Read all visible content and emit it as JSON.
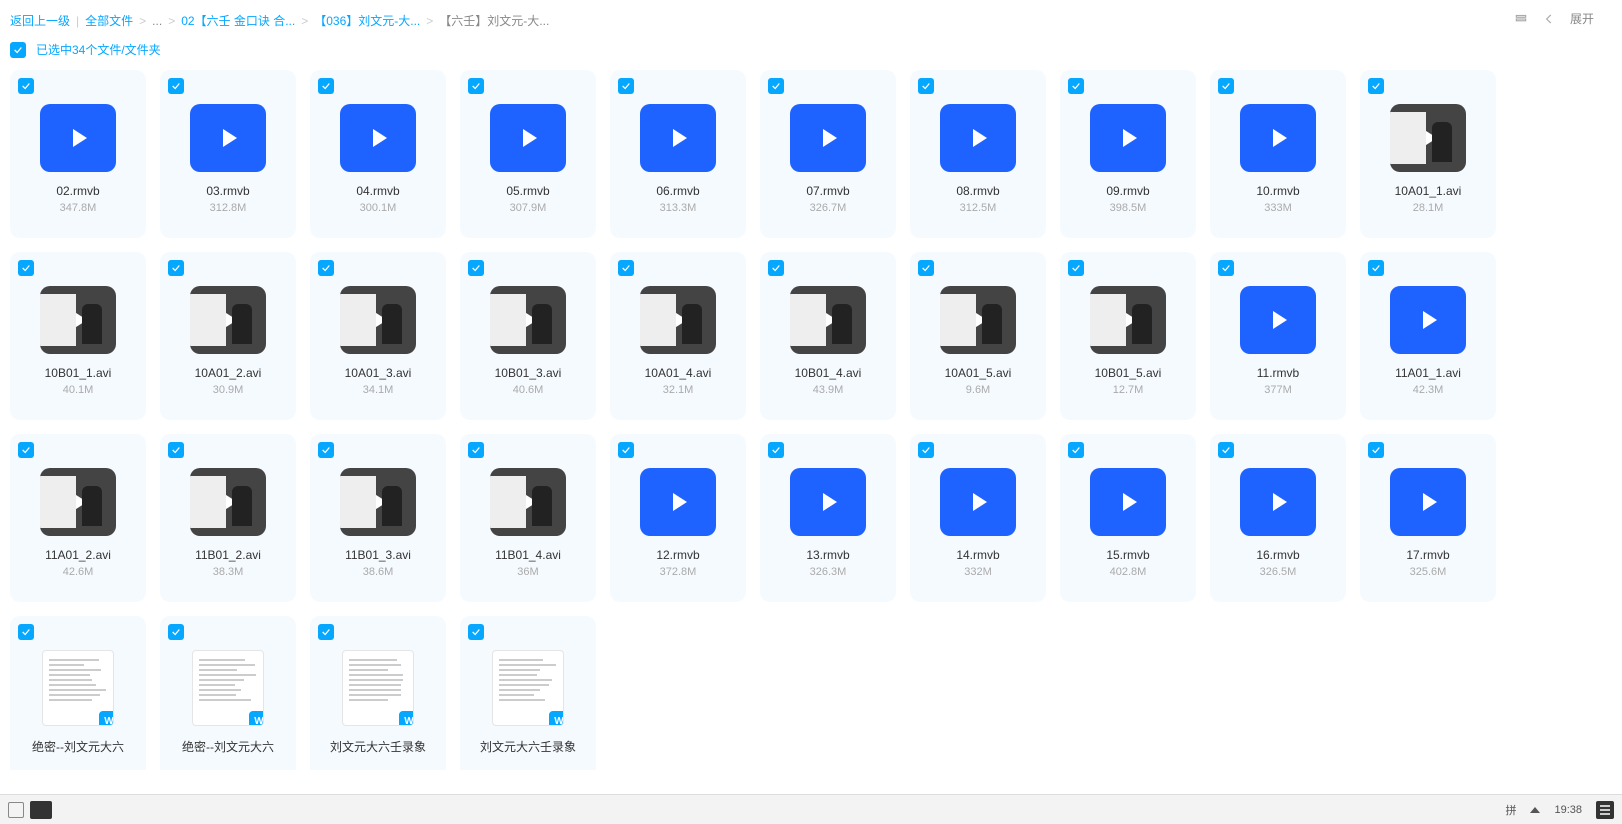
{
  "breadcrumb": {
    "back": "返回上一级",
    "root": "全部文件",
    "dots": "...",
    "p1": "02【六壬 金口诀 合...",
    "p2": "【036】刘文元-大...",
    "p3": "【六壬】刘文元-大..."
  },
  "topbar": {
    "expand": "展开"
  },
  "selection": {
    "text": "已选中34个文件/文件夹"
  },
  "taskbar": {
    "clock": "19:38",
    "ime": "拼"
  },
  "files": [
    {
      "name": "02.rmvb",
      "size": "347.8M",
      "kind": "blue"
    },
    {
      "name": "03.rmvb",
      "size": "312.8M",
      "kind": "blue"
    },
    {
      "name": "04.rmvb",
      "size": "300.1M",
      "kind": "blue"
    },
    {
      "name": "05.rmvb",
      "size": "307.9M",
      "kind": "blue"
    },
    {
      "name": "06.rmvb",
      "size": "313.3M",
      "kind": "blue"
    },
    {
      "name": "07.rmvb",
      "size": "326.7M",
      "kind": "blue"
    },
    {
      "name": "08.rmvb",
      "size": "312.5M",
      "kind": "blue"
    },
    {
      "name": "09.rmvb",
      "size": "398.5M",
      "kind": "blue"
    },
    {
      "name": "10.rmvb",
      "size": "333M",
      "kind": "blue"
    },
    {
      "name": "10A01_1.avi",
      "size": "28.1M",
      "kind": "person"
    },
    {
      "name": "10B01_1.avi",
      "size": "40.1M",
      "kind": "person"
    },
    {
      "name": "10A01_2.avi",
      "size": "30.9M",
      "kind": "person"
    },
    {
      "name": "10A01_3.avi",
      "size": "34.1M",
      "kind": "person"
    },
    {
      "name": "10B01_3.avi",
      "size": "40.6M",
      "kind": "person"
    },
    {
      "name": "10A01_4.avi",
      "size": "32.1M",
      "kind": "person"
    },
    {
      "name": "10B01_4.avi",
      "size": "43.9M",
      "kind": "person"
    },
    {
      "name": "10A01_5.avi",
      "size": "9.6M",
      "kind": "person"
    },
    {
      "name": "10B01_5.avi",
      "size": "12.7M",
      "kind": "person"
    },
    {
      "name": "11.rmvb",
      "size": "377M",
      "kind": "bluep"
    },
    {
      "name": "11A01_1.avi",
      "size": "42.3M",
      "kind": "bluep"
    },
    {
      "name": "11A01_2.avi",
      "size": "42.6M",
      "kind": "person"
    },
    {
      "name": "11B01_2.avi",
      "size": "38.3M",
      "kind": "person"
    },
    {
      "name": "11B01_3.avi",
      "size": "38.6M",
      "kind": "person"
    },
    {
      "name": "11B01_4.avi",
      "size": "36M",
      "kind": "person"
    },
    {
      "name": "12.rmvb",
      "size": "372.8M",
      "kind": "blue"
    },
    {
      "name": "13.rmvb",
      "size": "326.3M",
      "kind": "blue"
    },
    {
      "name": "14.rmvb",
      "size": "332M",
      "kind": "blue"
    },
    {
      "name": "15.rmvb",
      "size": "402.8M",
      "kind": "blue"
    },
    {
      "name": "16.rmvb",
      "size": "326.5M",
      "kind": "blue"
    },
    {
      "name": "17.rmvb",
      "size": "325.6M",
      "kind": "blue"
    },
    {
      "name": "绝密--刘文元大六",
      "size": "",
      "kind": "doc"
    },
    {
      "name": "绝密--刘文元大六",
      "size": "",
      "kind": "doc"
    },
    {
      "name": "刘文元大六壬录象",
      "size": "",
      "kind": "doc"
    },
    {
      "name": "刘文元大六壬录象",
      "size": "",
      "kind": "doc"
    }
  ]
}
